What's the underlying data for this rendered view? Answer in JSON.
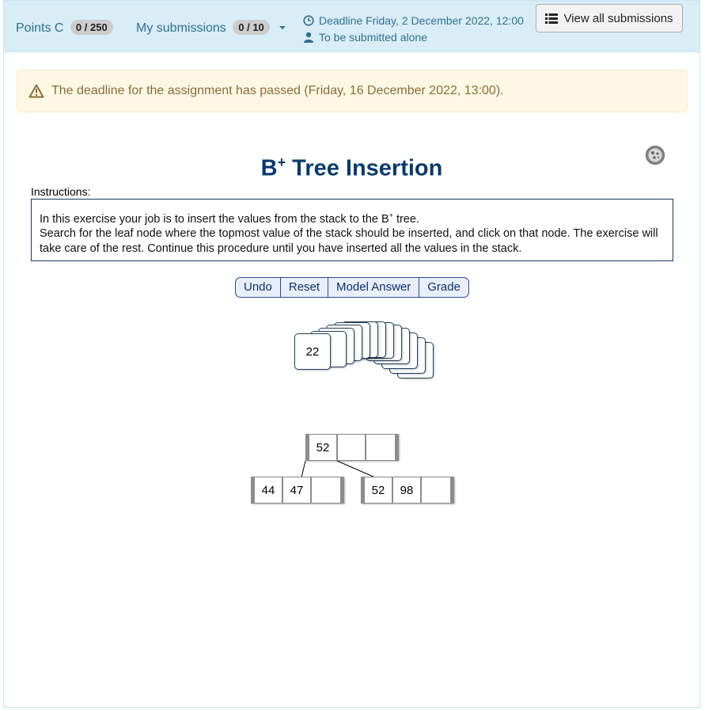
{
  "header": {
    "points_label": "Points C",
    "points_badge": "0 / 250",
    "submissions_label": "My submissions",
    "submissions_badge": "0 / 10",
    "deadline": "Deadline Friday, 2 December 2022, 12:00",
    "submit_mode": "To be submitted alone",
    "view_all_label": "View all submissions"
  },
  "alert": {
    "text": "The deadline for the assignment has passed (Friday, 16 December 2022, 13:00)."
  },
  "exercise": {
    "title_prefix": "B",
    "title_sup": "+",
    "title_suffix": " Tree Insertion",
    "instructions_label": "Instructions:",
    "instr_line1_pre": "In this exercise your job is to insert the values from the stack to the B",
    "instr_line1_sup": "+",
    "instr_line1_post": " tree.",
    "instr_rest": "Search for the leaf node where the topmost value of the stack should be inserted, and click on that node. The exercise will take care of the rest. Continue this procedure until you have inserted all the values in the stack.",
    "buttons": [
      "Undo",
      "Reset",
      "Model Answer",
      "Grade"
    ],
    "stack_top": "22",
    "root_values": [
      "52",
      "",
      ""
    ],
    "leaf_left_values": [
      "44",
      "47",
      ""
    ],
    "leaf_right_values": [
      "52",
      "98",
      ""
    ]
  }
}
